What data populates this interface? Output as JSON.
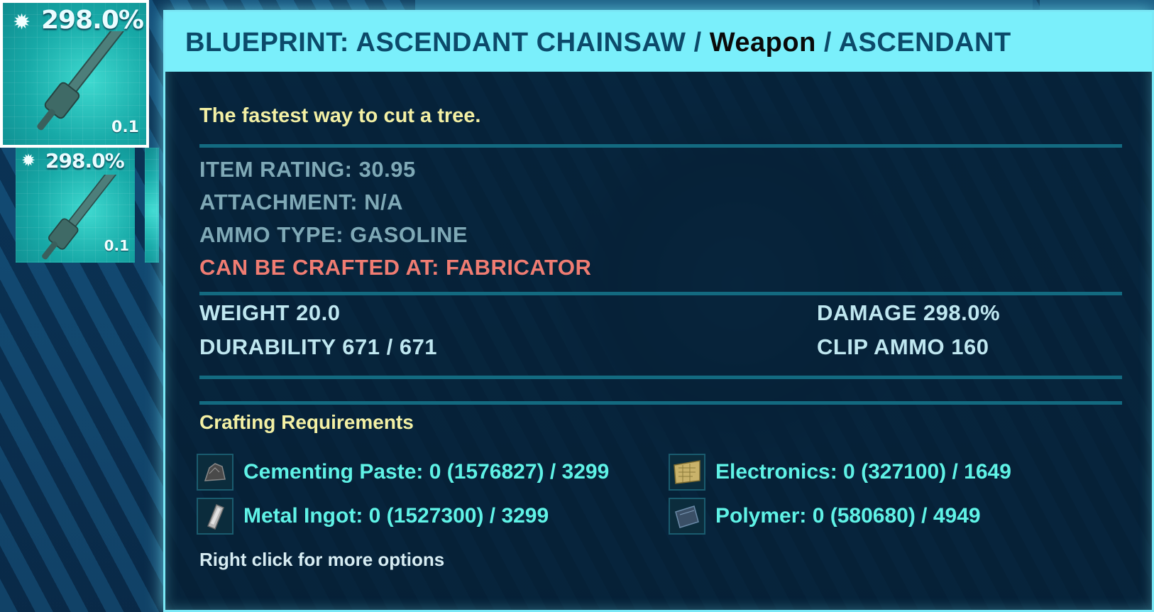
{
  "inventory": {
    "selected_slot": {
      "damage": "298.0%",
      "quantity": "0.1",
      "icon": "chainsaw-icon"
    },
    "second_slot": {
      "damage": "298.0%",
      "quantity": "0.1",
      "icon": "chainsaw-icon"
    }
  },
  "tooltip": {
    "title_main": "BLUEPRINT: ASCENDANT CHAINSAW",
    "sep1": " / ",
    "type": "Weapon",
    "sep2": " / ",
    "quality": "ASCENDANT",
    "description": "The fastest way to cut a tree.",
    "item_rating": "ITEM RATING: 30.95",
    "attachment": "ATTACHMENT: N/A",
    "ammo_type": "AMMO TYPE: GASOLINE",
    "crafted_at": "CAN BE CRAFTED AT: FABRICATOR",
    "weight": "WEIGHT 20.0",
    "durability": "DURABILITY 671 / 671",
    "damage": "DAMAGE 298.0%",
    "clip_ammo": "CLIP AMMO 160",
    "requirements_title": "Crafting Requirements",
    "requirements": [
      {
        "label": "Cementing Paste: 0 (1576827) / 3299",
        "icon": "cementing-paste-icon"
      },
      {
        "label": "Electronics: 0 (327100) / 1649",
        "icon": "electronics-icon"
      },
      {
        "label": "Metal Ingot: 0 (1527300) / 3299",
        "icon": "metal-ingot-icon"
      },
      {
        "label": "Polymer: 0 (580680) / 4949",
        "icon": "polymer-icon"
      }
    ],
    "hint": "Right click for more options"
  },
  "colors": {
    "header_bg": "#7aeffb",
    "title_text": "#0c4a6a",
    "description": "#f3f0a4",
    "crafted_at": "#f07c72",
    "requirement_text": "#5ff2e6"
  }
}
